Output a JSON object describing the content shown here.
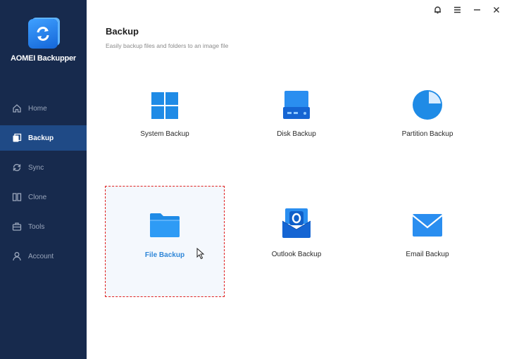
{
  "app": {
    "name": "AOMEI Backupper"
  },
  "window_controls": {
    "notification_icon": "bell-icon",
    "menu_icon": "hamburger-menu-icon",
    "minimize_icon": "minimize-icon",
    "close_icon": "close-icon"
  },
  "sidebar": {
    "items": [
      {
        "label": "Home",
        "icon": "home-icon",
        "active": false
      },
      {
        "label": "Backup",
        "icon": "backup-icon",
        "active": true
      },
      {
        "label": "Sync",
        "icon": "sync-icon",
        "active": false
      },
      {
        "label": "Clone",
        "icon": "clone-icon",
        "active": false
      },
      {
        "label": "Tools",
        "icon": "tools-icon",
        "active": false
      },
      {
        "label": "Account",
        "icon": "account-icon",
        "active": false
      }
    ]
  },
  "main": {
    "title": "Backup",
    "subtitle": "Easily backup files and folders to an image file",
    "options": [
      {
        "label": "System Backup",
        "icon": "windows-icon"
      },
      {
        "label": "Disk Backup",
        "icon": "disk-icon"
      },
      {
        "label": "Partition Backup",
        "icon": "pie-chart-icon"
      },
      {
        "label": "File Backup",
        "icon": "folder-icon",
        "selected": true
      },
      {
        "label": "Outlook Backup",
        "icon": "outlook-icon"
      },
      {
        "label": "Email Backup",
        "icon": "envelope-icon"
      }
    ]
  },
  "colors": {
    "sidebar_bg": "#172a4d",
    "sidebar_active": "#1f4a86",
    "accent": "#2e86d8",
    "highlight_border": "#e0201f"
  }
}
